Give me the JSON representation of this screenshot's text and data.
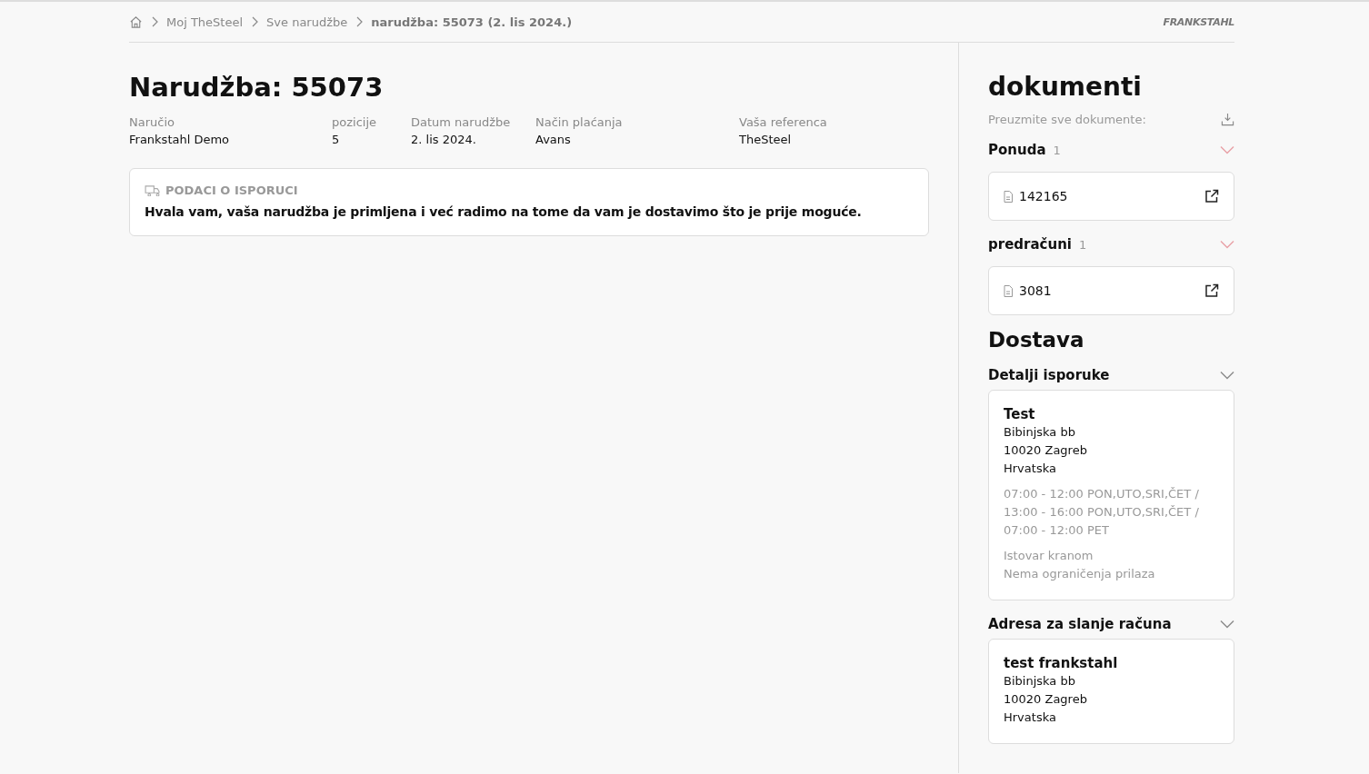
{
  "breadcrumb": [
    {
      "label": "Moj TheSteel",
      "current": false
    },
    {
      "label": "Sve narudžbe",
      "current": false
    },
    {
      "label": "narudžba: 55073 (2. lis 2024.)",
      "current": true
    }
  ],
  "logo": "FRANKSTAHL",
  "order": {
    "title": "Narudžba: 55073",
    "fields": [
      {
        "label": "Naručio",
        "value": "Frankstahl Demo"
      },
      {
        "label": "pozicije",
        "value": "5"
      },
      {
        "label": "Datum narudžbe",
        "value": "2. lis 2024."
      },
      {
        "label": "Način plaćanja",
        "value": "Avans"
      },
      {
        "label": "Vaša referenca",
        "value": "TheSteel"
      }
    ],
    "notice": {
      "heading": "PODACI O ISPORUCI",
      "message": "Hvala vam, vaša narudžba je primljena i već radimo na tome da vam je dostavimo što je prije moguće."
    }
  },
  "documents": {
    "title": "dokumenti",
    "download_all": "Preuzmite sve dokumente:",
    "groups": [
      {
        "name": "Ponuda",
        "count": "1",
        "expanded": true,
        "color": "#e8a0a6",
        "items": [
          "142165"
        ]
      },
      {
        "name": "predračuni",
        "count": "1",
        "expanded": true,
        "color": "#e8a0a6",
        "items": [
          "3081"
        ]
      }
    ]
  },
  "delivery": {
    "title": "Dostava",
    "sections": [
      {
        "name": "Detalji isporuke",
        "expanded": true,
        "color": "#8a8a8a",
        "card": {
          "name": "Test",
          "lines": [
            "Bibinjska bb",
            "10020 Zagreb",
            "Hrvatska"
          ],
          "hours": [
            "07:00 - 12:00 PON,UTO,SRI,ČET /",
            "13:00 - 16:00 PON,UTO,SRI,ČET /",
            "07:00 - 12:00 PET"
          ],
          "notes": [
            "Istovar kranom",
            "Nema ograničenja prilaza"
          ]
        }
      },
      {
        "name": "Adresa za slanje računa",
        "expanded": true,
        "color": "#8a8a8a",
        "card": {
          "name": "test frankstahl",
          "lines": [
            "Bibinjska bb",
            "10020 Zagreb",
            "Hrvatska"
          ]
        }
      }
    ]
  }
}
